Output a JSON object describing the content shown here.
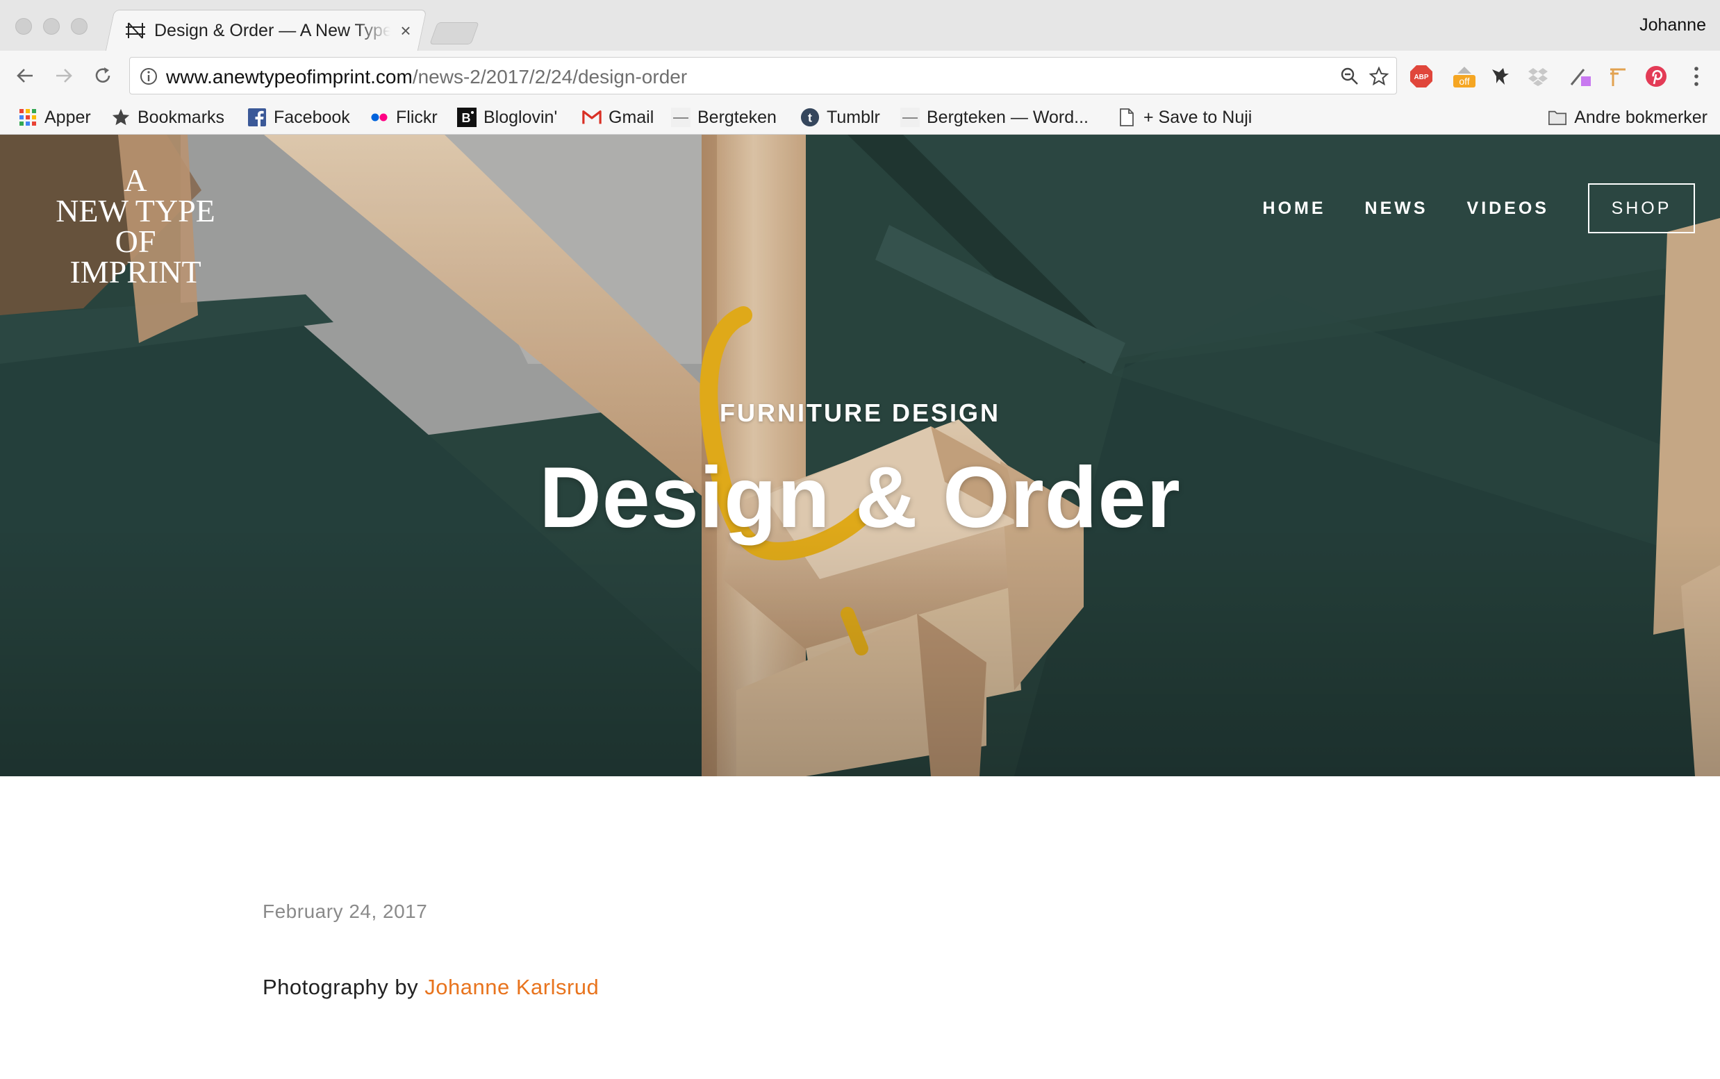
{
  "browser": {
    "tab": {
      "title": "Design & Order — A New Type of Imprint",
      "close": "×",
      "favicon": "anti-logo-icon"
    },
    "profile_name": "Johanne",
    "address_bar": {
      "host": "www.anewtypeofimprint.com",
      "path": "/news-2/2017/2/24/design-order"
    },
    "extensions": [
      "adblock-plus-icon",
      "honey-off-icon",
      "pocket-bat-icon",
      "dropbox-icon",
      "eyedropper-icon",
      "bookmark-pin-icon",
      "pinterest-icon",
      "menu-dots-icon"
    ],
    "extension_labels": {
      "adblock": "ABP",
      "honey": "off"
    },
    "bookmarks": [
      {
        "label": "Apper",
        "icon": "apps-grid-icon"
      },
      {
        "label": "Bookmarks",
        "icon": "star-icon"
      },
      {
        "label": "Facebook",
        "icon": "facebook-icon"
      },
      {
        "label": "Flickr",
        "icon": "flickr-icon"
      },
      {
        "label": "Bloglovin'",
        "icon": "bloglovin-icon"
      },
      {
        "label": "Gmail",
        "icon": "gmail-icon"
      },
      {
        "label": "Bergteken",
        "icon": "bergteken-icon"
      },
      {
        "label": "Tumblr",
        "icon": "tumblr-icon"
      },
      {
        "label": "Bergteken — Word...",
        "icon": "bergteken-icon"
      },
      {
        "label": "+ Save to Nuji",
        "icon": "page-icon"
      }
    ],
    "other_bookmarks": "Andre bokmerker"
  },
  "site": {
    "logo_lines": [
      "A",
      "NEW TYPE",
      "OF IMPRINT"
    ],
    "nav": [
      "HOME",
      "NEWS",
      "VIDEOS"
    ],
    "shop_label": "SHOP"
  },
  "post": {
    "category": "FURNITURE DESIGN",
    "title": "Design & Order",
    "date": "February 24, 2017",
    "credit_prefix": "Photography by",
    "credit_name": "Johanne Karlsrud"
  },
  "colors": {
    "accent_link": "#e8741e",
    "hero_green": "#2b4741",
    "wood": "#e7c9a6",
    "yellow_hook": "#f2b81c"
  }
}
